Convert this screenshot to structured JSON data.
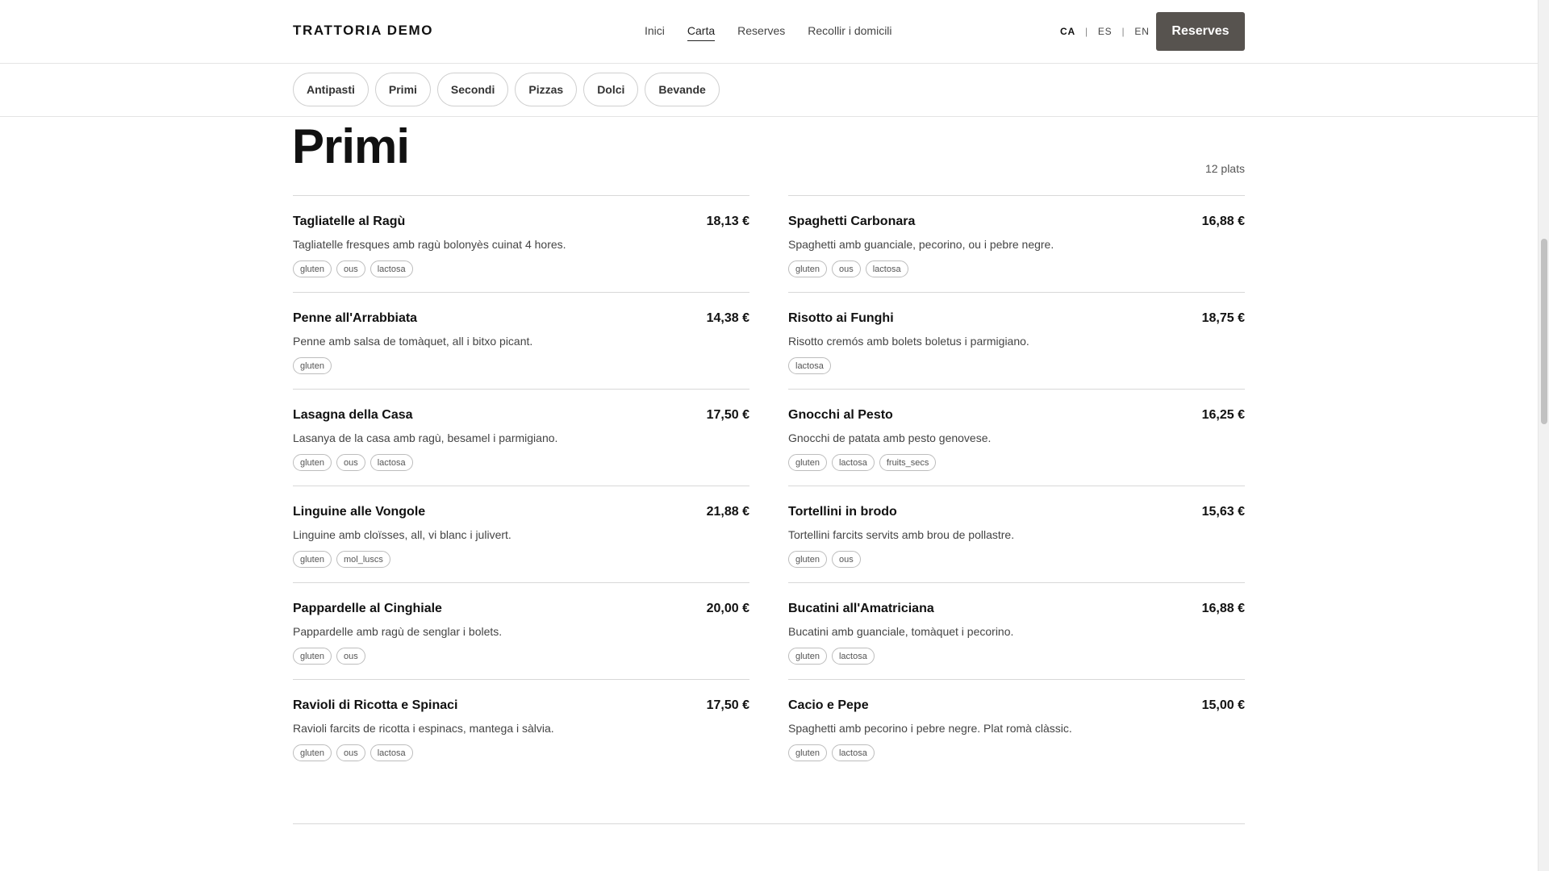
{
  "header": {
    "brand": "TRATTORIA DEMO",
    "nav": [
      {
        "label": "Inici",
        "active": false
      },
      {
        "label": "Carta",
        "active": true
      },
      {
        "label": "Reserves",
        "active": false
      },
      {
        "label": "Recollir i domicili",
        "active": false
      }
    ],
    "languages": [
      {
        "label": "CA",
        "active": true
      },
      {
        "label": "ES",
        "active": false
      },
      {
        "label": "EN",
        "active": false
      }
    ],
    "language_separator": "|",
    "reserve_button": "Reserves"
  },
  "categories": [
    "Antipasti",
    "Primi",
    "Secondi",
    "Pizzas",
    "Dolci",
    "Bevande"
  ],
  "section": {
    "title": "Primi",
    "count": "12 plats"
  },
  "dishes": [
    {
      "name": "Tagliatelle al Ragù",
      "price": "18,13 €",
      "desc": "Tagliatelle fresques amb ragù bolonyès cuinat 4 hores.",
      "tags": [
        "gluten",
        "ous",
        "lactosa"
      ]
    },
    {
      "name": "Spaghetti Carbonara",
      "price": "16,88 €",
      "desc": "Spaghetti amb guanciale, pecorino, ou i pebre negre.",
      "tags": [
        "gluten",
        "ous",
        "lactosa"
      ]
    },
    {
      "name": "Penne all'Arrabbiata",
      "price": "14,38 €",
      "desc": "Penne amb salsa de tomàquet, all i bitxo picant.",
      "tags": [
        "gluten"
      ]
    },
    {
      "name": "Risotto ai Funghi",
      "price": "18,75 €",
      "desc": "Risotto cremós amb bolets boletus i parmigiano.",
      "tags": [
        "lactosa"
      ]
    },
    {
      "name": "Lasagna della Casa",
      "price": "17,50 €",
      "desc": "Lasanya de la casa amb ragù, besamel i parmigiano.",
      "tags": [
        "gluten",
        "ous",
        "lactosa"
      ]
    },
    {
      "name": "Gnocchi al Pesto",
      "price": "16,25 €",
      "desc": "Gnocchi de patata amb pesto genovese.",
      "tags": [
        "gluten",
        "lactosa",
        "fruits_secs"
      ]
    },
    {
      "name": "Linguine alle Vongole",
      "price": "21,88 €",
      "desc": "Linguine amb cloïsses, all, vi blanc i julivert.",
      "tags": [
        "gluten",
        "mol_luscs"
      ]
    },
    {
      "name": "Tortellini in brodo",
      "price": "15,63 €",
      "desc": "Tortellini farcits servits amb brou de pollastre.",
      "tags": [
        "gluten",
        "ous"
      ]
    },
    {
      "name": "Pappardelle al Cinghiale",
      "price": "20,00 €",
      "desc": "Pappardelle amb ragù de senglar i bolets.",
      "tags": [
        "gluten",
        "ous"
      ]
    },
    {
      "name": "Bucatini all'Amatriciana",
      "price": "16,88 €",
      "desc": "Bucatini amb guanciale, tomàquet i pecorino.",
      "tags": [
        "gluten",
        "lactosa"
      ]
    },
    {
      "name": "Ravioli di Ricotta e Spinaci",
      "price": "17,50 €",
      "desc": "Ravioli farcits de ricotta i espinacs, mantega i sàlvia.",
      "tags": [
        "gluten",
        "ous",
        "lactosa"
      ]
    },
    {
      "name": "Cacio e Pepe",
      "price": "15,00 €",
      "desc": "Spaghetti amb pecorino i pebre negre. Plat romà clàssic.",
      "tags": [
        "gluten",
        "lactosa"
      ]
    }
  ],
  "colors": {
    "button_bg": "#57534f",
    "text": "#111111",
    "border": "#d8d8d8"
  }
}
